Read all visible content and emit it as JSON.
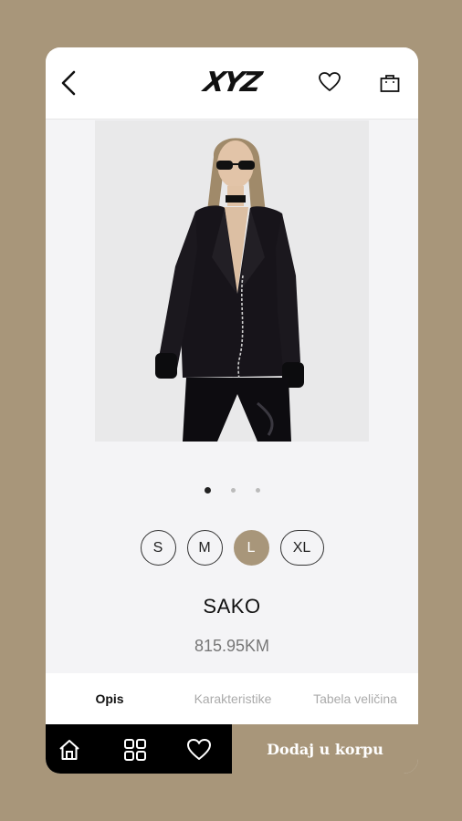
{
  "header": {
    "logo_text": "XYZ",
    "icons": [
      "back-arrow-icon",
      "heart-icon",
      "shopping-bag-icon"
    ]
  },
  "carousel": {
    "image_count": 3,
    "active_index": 0
  },
  "sizes": [
    {
      "label": "S",
      "selected": false
    },
    {
      "label": "M",
      "selected": false
    },
    {
      "label": "L",
      "selected": true
    },
    {
      "label": "XL",
      "selected": false
    }
  ],
  "product": {
    "name": "SAKO",
    "price": "815.95KM"
  },
  "tabs": [
    {
      "label": "Opis",
      "active": true
    },
    {
      "label": "Karakteristike",
      "active": false
    },
    {
      "label": "Tabela veličina",
      "active": false
    }
  ],
  "bottom_nav": {
    "icons": [
      "home-icon",
      "grid-icon",
      "heart-icon"
    ],
    "cart_button_label": "Dodaj u korpu"
  },
  "colors": {
    "accent": "#a8967a",
    "bar": "#000000",
    "card": "#f4f4f6"
  }
}
